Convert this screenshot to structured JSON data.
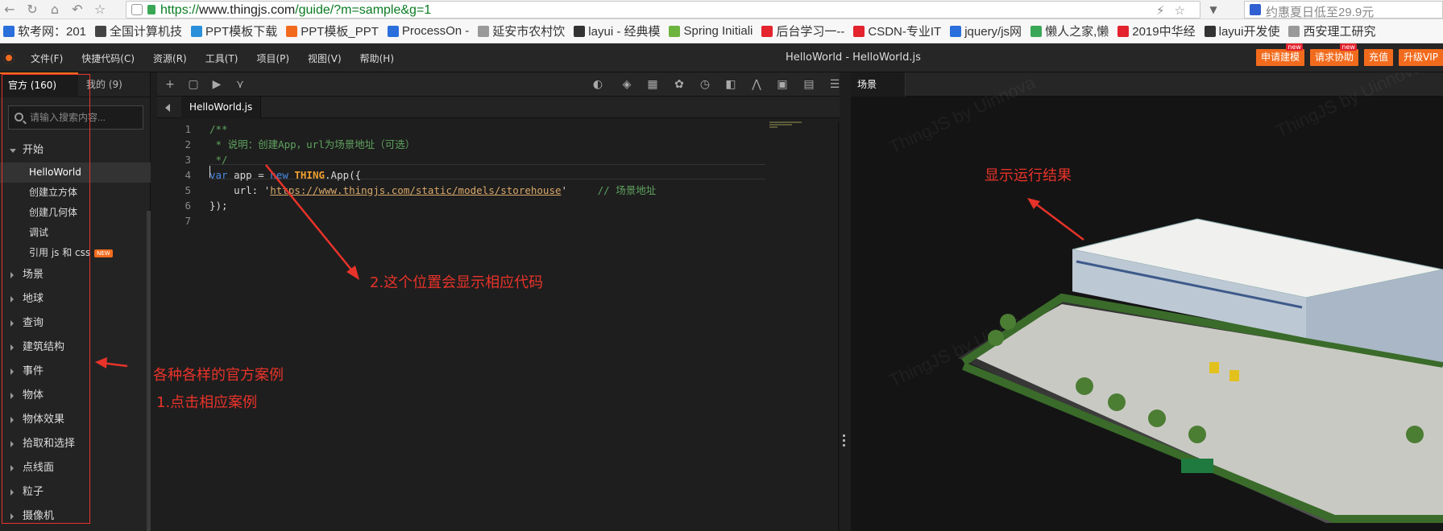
{
  "browser": {
    "url_scheme": "https://",
    "url_host": "www.thingjs.com",
    "url_path": "/guide/?m=sample&g=1",
    "search_text": "约惠夏日低至29.9元"
  },
  "bookmarks": [
    {
      "label": "软考网：201",
      "color": "#2a6fdb"
    },
    {
      "label": "全国计算机技",
      "color": "#444"
    },
    {
      "label": "PPT模板下载",
      "color": "#2a8fdb"
    },
    {
      "label": "PPT模板_PPT",
      "color": "#f26b1d"
    },
    {
      "label": "ProcessOn -",
      "color": "#2a6fdb"
    },
    {
      "label": "延安市农村饮",
      "color": "#999"
    },
    {
      "label": "layui - 经典模",
      "color": "#333"
    },
    {
      "label": "Spring Initiali",
      "color": "#6db33f"
    },
    {
      "label": "后台学习一--",
      "color": "#e3232d"
    },
    {
      "label": "CSDN-专业IT",
      "color": "#e3232d"
    },
    {
      "label": "jquery/js网",
      "color": "#2a6fdb"
    },
    {
      "label": "懒人之家,懒",
      "color": "#3aa757"
    },
    {
      "label": "2019中华经",
      "color": "#e3232d"
    },
    {
      "label": "layui开发使",
      "color": "#333"
    },
    {
      "label": "西安理工研究",
      "color": "#999"
    }
  ],
  "app": {
    "menu": [
      "文件(F)",
      "快捷代码(C)",
      "资源(R)",
      "工具(T)",
      "项目(P)",
      "视图(V)",
      "帮助(H)"
    ],
    "title": "HelloWorld -  HelloWorld.js",
    "actions": [
      {
        "label": "申请建模",
        "badge": "new"
      },
      {
        "label": "请求协助",
        "badge": "new"
      },
      {
        "label": "充值",
        "badge": ""
      },
      {
        "label": "升级VIP",
        "badge": ""
      }
    ]
  },
  "sidebar": {
    "tab_official": "官方 (160)",
    "tab_mine": "我的 (9)",
    "search_placeholder": "请输入搜索内容...",
    "start_group": "开始",
    "start_children": [
      "HelloWorld",
      "创建立方体",
      "创建几何体",
      "调试",
      "引用 js 和 css"
    ],
    "new_tag": "NEW",
    "groups": [
      "场景",
      "地球",
      "查询",
      "建筑结构",
      "事件",
      "物体",
      "物体效果",
      "拾取和选择",
      "点线面",
      "粒子",
      "摄像机"
    ]
  },
  "editor": {
    "file_tab": "HelloWorld.js",
    "lines": [
      {
        "n": "1",
        "parts": [
          [
            "cm",
            "/**"
          ]
        ]
      },
      {
        "n": "2",
        "parts": [
          [
            "cm",
            " * 说明：创建App，url为场景地址（可选）"
          ]
        ]
      },
      {
        "n": "3",
        "parts": [
          [
            "cm",
            " */"
          ]
        ]
      },
      {
        "n": "4",
        "parts": [
          [
            "kw",
            "var"
          ],
          [
            "",
            " app = "
          ],
          [
            "kw",
            "new"
          ],
          [
            "",
            " "
          ],
          [
            "cls",
            "THING"
          ],
          [
            "",
            ".App({"
          ]
        ]
      },
      {
        "n": "5",
        "parts": [
          [
            "",
            "    url: '"
          ],
          [
            "str",
            "https://www.thingjs.com/static/models/storehouse"
          ],
          [
            "",
            "'     "
          ],
          [
            "cm",
            "// 场景地址"
          ]
        ]
      },
      {
        "n": "6",
        "parts": [
          [
            "",
            "});"
          ]
        ]
      },
      {
        "n": "7",
        "parts": [
          [
            "",
            ""
          ]
        ]
      }
    ]
  },
  "scene": {
    "tab": "场景",
    "watermark": "ThingJS by Uinnova"
  },
  "annotations": {
    "result": "显示运行结果",
    "code": "2.这个位置会显示相应代码",
    "cases": "各种各样的官方案例",
    "click": "1.点击相应案例"
  }
}
